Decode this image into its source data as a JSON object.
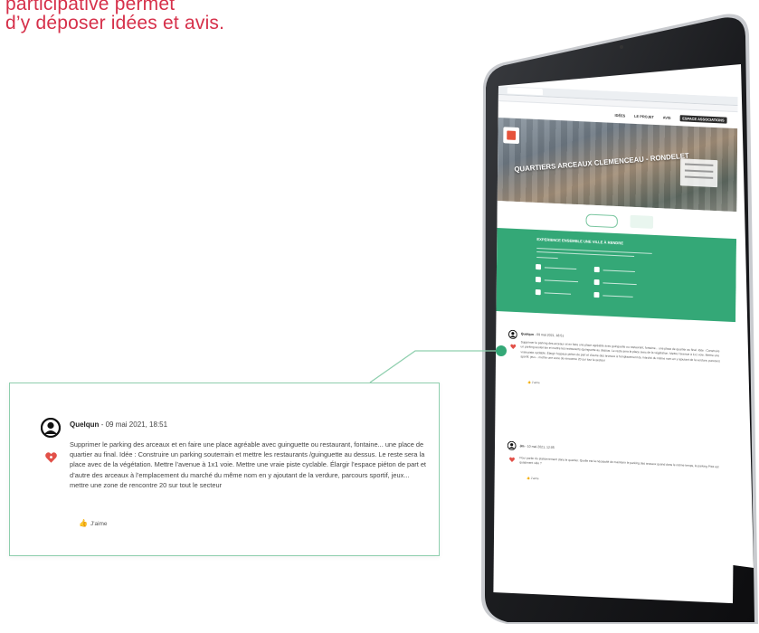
{
  "headline": {
    "lines": [
      "participative permet",
      "d’y déposer idées et avis."
    ]
  },
  "comments": [
    {
      "author": "Quelqun",
      "date": "- 09 mai 2021, 18:51",
      "text": "Supprimer le parking des arceaux et en faire une place agréable avec guinguette ou restaurant, fontaine... une place de quartier au final. Idée : Construire un parking souterrain et mettre les restaurants /guinguette au dessus. Le reste sera la place avec de la végétation. Mettre l’avenue à 1x1 voie. Mettre une vraie piste cyclable. Élargir l’espace piéton de part et d’autre des arceaux à l’emplacement du marché du même nom en y ajoutant de la verdure, parcours sportif, jeux... mettre une zone de rencontre 20 sur tout le secteur",
      "like_label": "J'aime"
    },
    {
      "author": "Jm",
      "date": "- 10 mai 2021, 12:05",
      "text": "Pour parler du stationnement dans le quartier. Quelle est la nécessité de maintenir le parking des arceaux quand dans le même temps, le parking Pitot est quasiment vide ?",
      "like_label": "J'aime"
    }
  ],
  "screen": {
    "nav_items": [
      "IDÉES",
      "LE PROJET",
      "AVIS",
      "ESPACE ASSOCIATIONS"
    ],
    "hero_title": "QUARTIERS ARCEAUX CLEMENCEAU - RONDELET",
    "green_title": "EXPERIENCE ENSEMBLE UNE VILLE À RENDRE"
  },
  "colors": {
    "headline": "#d6304a",
    "accent_green": "#34a877",
    "card_border": "#8fcfae",
    "heart": "#e25048"
  },
  "icons": [
    "user-avatar-icon",
    "heart-icon",
    "thumbs-up-icon"
  ]
}
